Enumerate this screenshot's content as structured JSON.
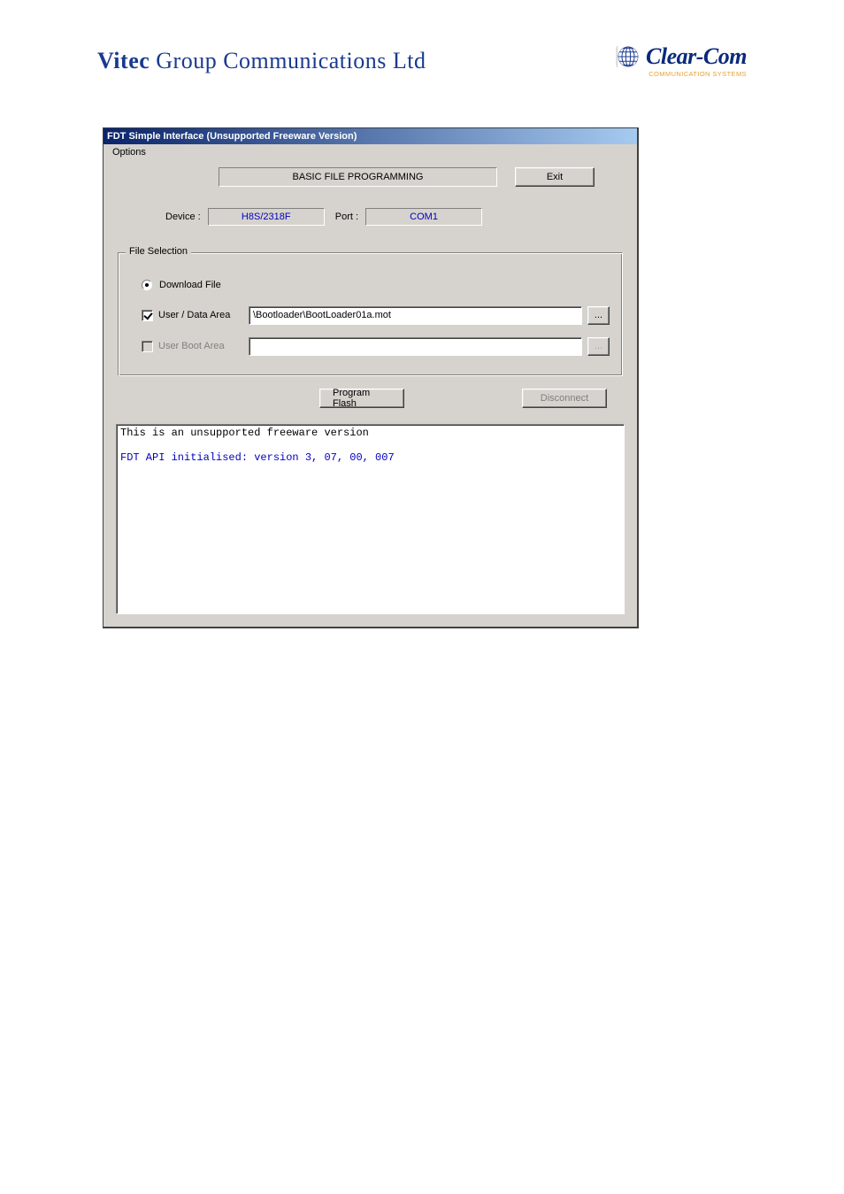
{
  "header": {
    "vitec_bold": "Vitec",
    "vitec_rest": " Group Communications Ltd",
    "clearcom_name": "Clear-Com",
    "clearcom_sub": "COMMUNICATION SYSTEMS"
  },
  "window": {
    "title": "FDT Simple Interface   (Unsupported Freeware Version)",
    "menu": {
      "options": "Options"
    },
    "header_panel": {
      "caption": "BASIC FILE PROGRAMMING",
      "exit": "Exit"
    },
    "device_row": {
      "device_label": "Device :",
      "device_value": "H8S/2318F",
      "port_label": "Port :",
      "port_value": "COM1"
    },
    "file_selection": {
      "group_title": "File Selection",
      "download_file_label": "Download File",
      "download_file_checked": true,
      "user_data_area": {
        "label": "User / Data Area",
        "checked": true,
        "path": "\\Bootloader\\BootLoader01a.mot",
        "browse": "..."
      },
      "user_boot_area": {
        "label": "User Boot Area",
        "checked": false,
        "path": "",
        "browse": "..."
      }
    },
    "actions": {
      "program_flash": "Program Flash",
      "disconnect": "Disconnect"
    },
    "log": {
      "line1": "This is an unsupported freeware version",
      "line2": "FDT API initialised: version 3, 07, 00, 007"
    }
  }
}
